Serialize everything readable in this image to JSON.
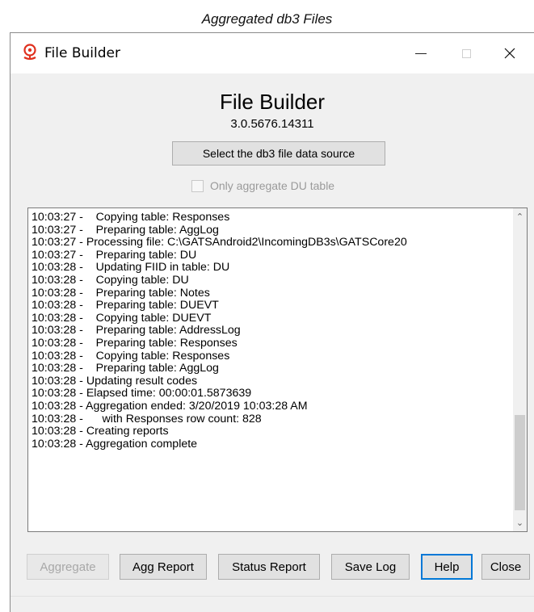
{
  "caption": "Aggregated db3 Files",
  "window": {
    "title": "File Builder",
    "app_icon": "red-globe-stand-icon"
  },
  "header": {
    "title": "File Builder",
    "version": "3.0.5676.14311"
  },
  "source_button_label": "Select the db3 file data source",
  "only_du_checkbox": {
    "label": "Only aggregate DU table",
    "checked": false,
    "enabled": false
  },
  "log_lines": [
    "10:03:27 -    Copying table: Responses",
    "10:03:27 -    Preparing table: AggLog",
    "10:03:27 - Processing file: C:\\GATSAndroid2\\IncomingDB3s\\GATSCore20",
    "10:03:27 -    Preparing table: DU",
    "10:03:28 -    Updating FIID in table: DU",
    "10:03:28 -    Copying table: DU",
    "10:03:28 -    Preparing table: Notes",
    "10:03:28 -    Preparing table: DUEVT",
    "10:03:28 -    Copying table: DUEVT",
    "10:03:28 -    Preparing table: AddressLog",
    "10:03:28 -    Preparing table: Responses",
    "10:03:28 -    Copying table: Responses",
    "10:03:28 -    Preparing table: AggLog",
    "10:03:28 - Updating result codes",
    "10:03:28 - Elapsed time: 00:00:01.5873639",
    "10:03:28 - Aggregation ended: 3/20/2019 10:03:28 AM",
    "10:03:28 -      with Responses row count: 828",
    "10:03:28 - Creating reports",
    "10:03:28 - Aggregation complete"
  ],
  "buttons": {
    "aggregate": "Aggregate",
    "agg_report": "Agg Report",
    "status_report": "Status Report",
    "save_log": "Save Log",
    "help": "Help",
    "close": "Close"
  },
  "colors": {
    "focus_border": "#0078d7",
    "icon_red": "#e0301e"
  }
}
